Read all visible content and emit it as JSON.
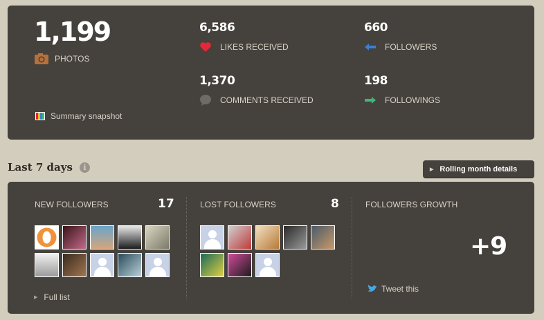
{
  "summary": {
    "photos": {
      "value": "1,199",
      "label": "PHOTOS",
      "icon": "camera-icon"
    },
    "likes": {
      "value": "6,586",
      "label": "LIKES RECEIVED",
      "icon": "heart-icon"
    },
    "comments": {
      "value": "1,370",
      "label": "COMMENTS RECEIVED",
      "icon": "comment-bubble-icon"
    },
    "followers": {
      "value": "660",
      "label": "FOLLOWERS",
      "icon": "arrow-left-icon"
    },
    "followings": {
      "value": "198",
      "label": "FOLLOWINGS",
      "icon": "arrow-right-icon"
    },
    "snapshot_label": "Summary snapshot"
  },
  "section": {
    "title": "Last 7 days",
    "info_glyph": "i",
    "rolling_button": "Rolling month details"
  },
  "weekly": {
    "new_followers": {
      "title": "NEW FOLLOWERS",
      "count": "17",
      "full_list": "Full list",
      "avatars": [
        "orange-logo",
        "photo",
        "photo",
        "photo",
        "photo",
        "photo",
        "photo",
        "default",
        "photo",
        "default"
      ]
    },
    "lost_followers": {
      "title": "LOST FOLLOWERS",
      "count": "8",
      "avatars": [
        "default",
        "photo",
        "photo",
        "photo",
        "photo",
        "photo",
        "photo",
        "default"
      ]
    },
    "growth": {
      "title": "FOLLOWERS GROWTH",
      "value": "+9",
      "tweet_label": "Tweet this"
    }
  },
  "colors": {
    "background": "#d3cdbd",
    "panel": "#45413c",
    "like": "#e5273a",
    "followers_arrow": "#3a7fd6",
    "followings_arrow": "#3fb77a",
    "twitter": "#46a8e0"
  }
}
